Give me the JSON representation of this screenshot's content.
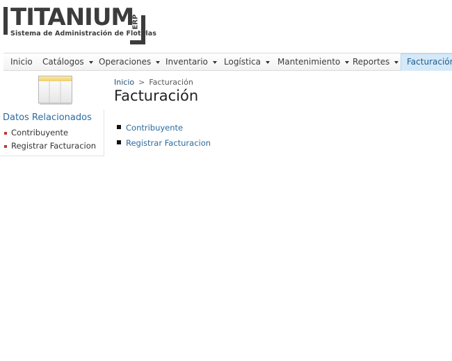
{
  "logo": {
    "word": "TITANIUM",
    "erp": "ERP",
    "subtitle": "Sistema de Administración de Flotillas",
    "reg": "®"
  },
  "nav": {
    "items": [
      {
        "label": "Inicio",
        "dropdown": false
      },
      {
        "label": "Catálogos",
        "dropdown": true
      },
      {
        "label": "Operaciones",
        "dropdown": true
      },
      {
        "label": "Inventario",
        "dropdown": true
      },
      {
        "label": "Logística",
        "dropdown": true
      },
      {
        "label": "Mantenimiento",
        "dropdown": true
      },
      {
        "label": "Reportes",
        "dropdown": true
      },
      {
        "label": "Facturación",
        "dropdown": false,
        "active": true
      }
    ]
  },
  "left": {
    "icon": "page-layout-icon",
    "title": "Datos Relacionados",
    "items": [
      "Contribuyente",
      "Registrar Facturacion"
    ]
  },
  "breadcrumb": {
    "home": "Inicio",
    "separator": ">",
    "current": "Facturación"
  },
  "page_title": "Facturación",
  "links": [
    "Contribuyente",
    "Registrar Facturacion"
  ],
  "colors": {
    "accent": "#2a6aa0",
    "active_tab_bg": "#d5e9f8",
    "bullet_red": "#c0392b",
    "logo_dark": "#3c3c3c"
  }
}
